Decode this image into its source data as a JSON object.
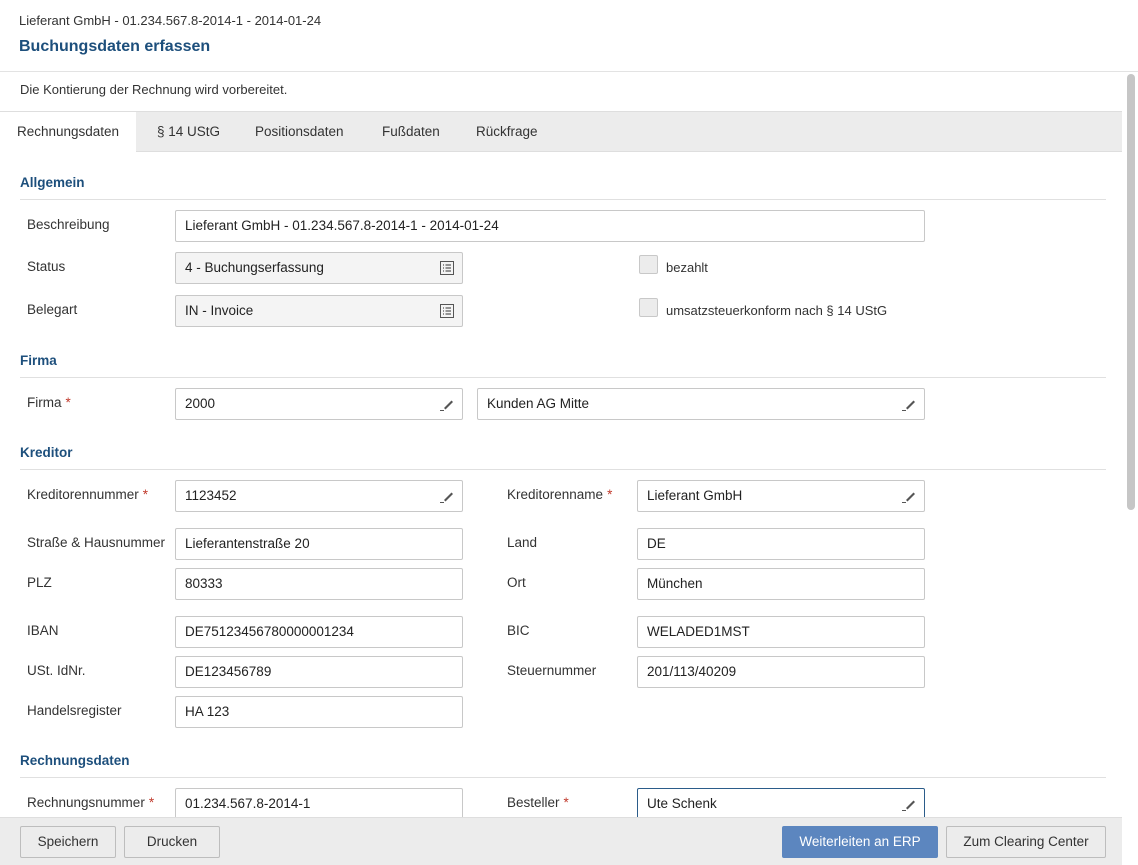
{
  "header": {
    "breadcrumb": "Lieferant GmbH - 01.234.567.8-2014-1 - 2014-01-24",
    "title": "Buchungsdaten erfassen"
  },
  "info": "Die Kontierung der Rechnung wird vorbereitet.",
  "tabs": [
    "Rechnungsdaten",
    "§ 14 UStG",
    "Positionsdaten",
    "Fußdaten",
    "Rückfrage"
  ],
  "sections": {
    "allgemein": "Allgemein",
    "firma": "Firma",
    "kreditor": "Kreditor",
    "rechnungsdaten": "Rechnungsdaten"
  },
  "allgemein": {
    "beschreibung_label": "Beschreibung",
    "beschreibung": "Lieferant GmbH - 01.234.567.8-2014-1 - 2014-01-24",
    "status_label": "Status",
    "status": "4 - Buchungserfassung",
    "belegart_label": "Belegart",
    "belegart": "IN - Invoice",
    "bezahlt_label": "bezahlt",
    "bezahlt_checked": false,
    "ustg_label": "umsatzsteuerkonform nach § 14 UStG",
    "ustg_checked": false
  },
  "firma": {
    "label": "Firma",
    "code": "2000",
    "name": "Kunden AG Mitte"
  },
  "kreditor": {
    "nummer_label": "Kreditorennummer",
    "nummer": "1123452",
    "name_label": "Kreditorenname",
    "name": "Lieferant GmbH",
    "strasse_label": "Straße & Hausnummer",
    "strasse": "Lieferantenstraße 20",
    "land_label": "Land",
    "land": "DE",
    "plz_label": "PLZ",
    "plz": "80333",
    "ort_label": "Ort",
    "ort": "München",
    "iban_label": "IBAN",
    "iban": "DE75123456780000001234",
    "bic_label": "BIC",
    "bic": "WELADED1MST",
    "ustid_label": "USt. IdNr.",
    "ustid": "DE123456789",
    "steuer_label": "Steuernummer",
    "steuer": "201/113/40209",
    "hr_label": "Handelsregister",
    "hr": "HA 123"
  },
  "rechnung": {
    "nummer_label": "Rechnungsnummer",
    "nummer": "01.234.567.8-2014-1",
    "besteller_label": "Besteller",
    "besteller": "Ute Schenk"
  },
  "footer": {
    "save": "Speichern",
    "print": "Drucken",
    "forward": "Weiterleiten an ERP",
    "clearing": "Zum Clearing Center"
  },
  "colors": {
    "title": "#1d4f7c",
    "primary_button": "#5c86bf",
    "required": "#c0392b"
  },
  "icons": {
    "select": "list-select-icon",
    "edit": "pencil-edit-icon"
  }
}
